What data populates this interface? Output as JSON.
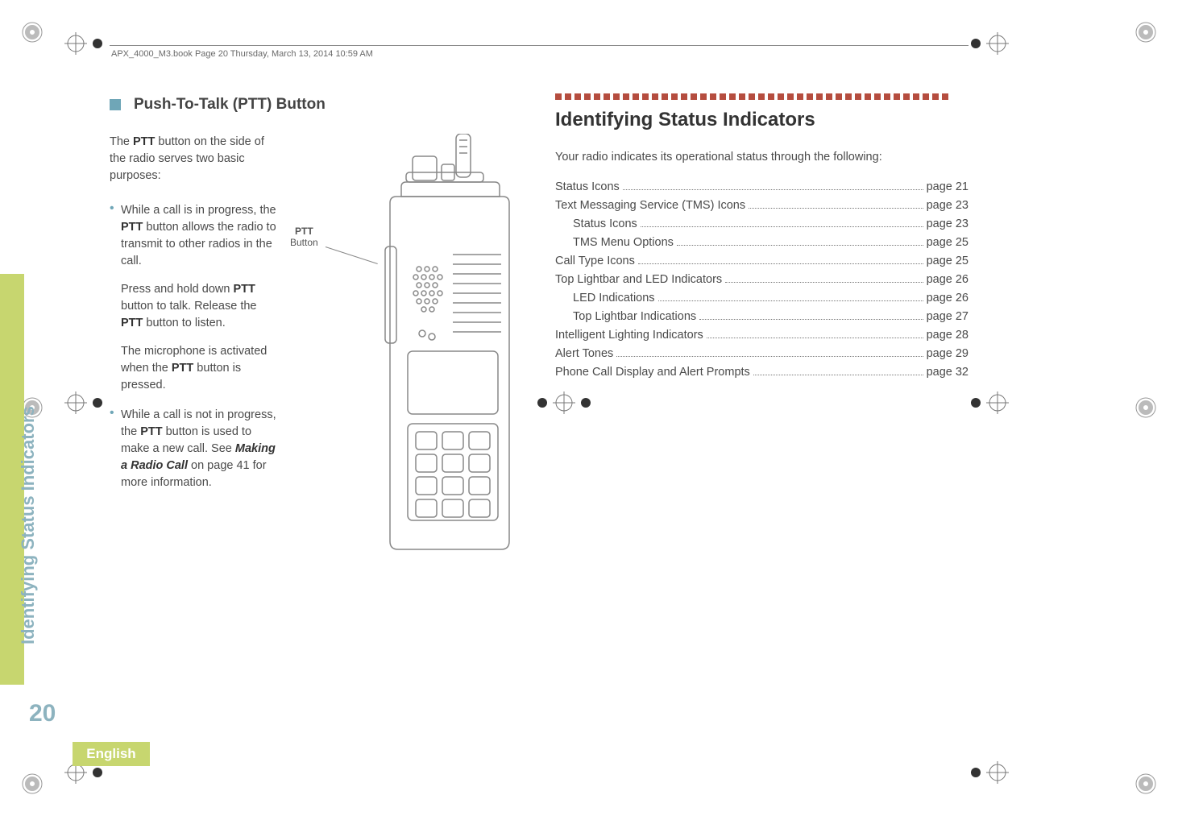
{
  "header_line": "APX_4000_M3.book  Page 20  Thursday, March 13, 2014  10:59 AM",
  "side_chapter_title": "Identifying Status Indicators",
  "page_number": "20",
  "footer_language": "English",
  "left": {
    "heading": "Push-To-Talk (PTT) Button",
    "intro_pre": "The ",
    "intro_b1": "PTT",
    "intro_post": " button on the side of the radio serves two basic purposes:",
    "bul1_a": "While a call is in progress, the ",
    "bul1_b": "PTT",
    "bul1_c": " button allows the radio to transmit to other radios in the call.",
    "bul1_p2a": "Press and hold down ",
    "bul1_p2b": "PTT",
    "bul1_p2c": " button to talk. Release the ",
    "bul1_p2d": "PTT",
    "bul1_p2e": " button to listen.",
    "bul1_p3a": "The microphone is activated when the ",
    "bul1_p3b": "PTT",
    "bul1_p3c": " button is pressed.",
    "bul2_a": "While a call is not in progress, the ",
    "bul2_b": "PTT",
    "bul2_c": " button is used to make a new call. See ",
    "bul2_ib": "Making a Radio Call",
    "bul2_d": " on page 41 for more information.",
    "ptt_label_l1": "PTT",
    "ptt_label_l2": "Button"
  },
  "right": {
    "heading": "Identifying Status Indicators",
    "lead": "Your radio indicates its operational status through the following:",
    "toc": [
      {
        "label": "Status Icons",
        "page": "page 21",
        "indent": false
      },
      {
        "label": "Text Messaging Service (TMS) Icons",
        "page": "page 23",
        "indent": false
      },
      {
        "label": "Status Icons",
        "page": "page 23",
        "indent": true
      },
      {
        "label": "TMS Menu Options",
        "page": "page 25",
        "indent": true
      },
      {
        "label": "Call Type Icons",
        "page": "page 25",
        "indent": false
      },
      {
        "label": "Top Lightbar and LED Indicators",
        "page": "page 26",
        "indent": false
      },
      {
        "label": "LED Indications",
        "page": "page 26",
        "indent": true
      },
      {
        "label": "Top Lightbar Indications",
        "page": "page 27",
        "indent": true
      },
      {
        "label": "Intelligent Lighting Indicators",
        "page": "page 28",
        "indent": false
      },
      {
        "label": "Alert Tones",
        "page": "page 29",
        "indent": false
      },
      {
        "label": "Phone Call Display and Alert Prompts",
        "page": "page 32",
        "indent": false
      }
    ]
  }
}
